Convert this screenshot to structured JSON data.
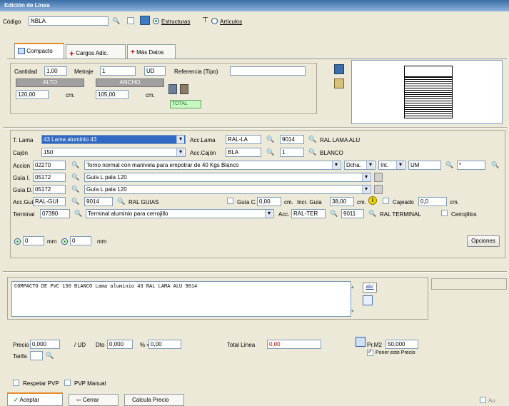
{
  "window": {
    "title": "Edición de Línea"
  },
  "top": {
    "codigo_label": "Código",
    "codigo_value": "NBLA",
    "estructuras_label": "Estructuras",
    "articulos_label": "Artículos"
  },
  "tabs": [
    {
      "label": "Compacto"
    },
    {
      "label": "Cargos Adic."
    },
    {
      "label": "Más Datos"
    }
  ],
  "dims": {
    "cantidad_label": "Cantidad",
    "cantidad_value": "1,00",
    "metraje_label": "Metraje",
    "metraje_value": "1",
    "unit_value": "UD",
    "referencia_label": "Referencia (Tipo)",
    "referencia_value": "",
    "alto_header": "ALTO",
    "ancho_header": "ANCHO",
    "alto_value": "120,00",
    "ancho_value": "105,00",
    "cm_label": "cm.",
    "total_label": "TOTAL"
  },
  "detail": {
    "tlama_label": "T. Lama",
    "tlama_value": "43 Lama aluminio 43",
    "acclama_label": "Acc.Lama",
    "acclama_code": "RAL-LA",
    "acclama_num": "9014",
    "acclama_desc": "RAL LAMA ALU",
    "cajon_label": "Cajón",
    "cajon_value": "150",
    "acccajon_label": "Acc.Cajón",
    "acccajon_code": "BLA",
    "acccajon_num": "1",
    "acccajon_desc": "BLANCO",
    "accion_label": "Accion",
    "accion_code": "02270",
    "accion_desc": "Torno normal con manivela  para empotrar de 40 Kgs Blanco",
    "dcha_value": "Dcha.",
    "int_value": "Int.",
    "um_value": "UM",
    "accion_extra": "*",
    "guiai_label": "Guía I.",
    "guiai_code": "05172",
    "guiai_desc": "Guía L pala 120",
    "guiad_label": "Guía D.",
    "guiad_code": "05172",
    "guiad_desc": "Guía L pala 120",
    "accgui_label": "Acc.Guí",
    "accgui_code": "RAL-GUI",
    "accgui_num": "9014",
    "accgui_desc": "RAL GUIAS",
    "guiac_label": "Guía C.",
    "guiac_value": "0,00",
    "cm_label": "cm.",
    "incr_label": "Incr. Guía",
    "incr_value": "38,00",
    "cajeado_label": "Cajeado",
    "cajeado_value": "0,0",
    "terminal_label": "Terminal",
    "terminal_code": "07390",
    "terminal_desc": "Terminal aluminio para cerrojillo",
    "accter_label": "Acc.",
    "accter_code": "RAL-TER",
    "accter_num": "9011",
    "accter_desc": "RAL TERMINAL",
    "cerrojillos_label": "Cerrojillos",
    "mm1_value": "0",
    "mm2_value": "0",
    "mm_label": "mm",
    "opciones_label": "Opciones"
  },
  "desc": {
    "text": "COMPACTO DE PVC  150  BLANCO  Lama aluminio 43  RAL LAMA ALU 9014",
    "abc_label": "abc"
  },
  "price": {
    "precio_label": "Precio",
    "precio_value": "0,000",
    "per_ud": "/ UD",
    "dto_label": "Dto",
    "dto_value": "0,000",
    "pct_label": "% =",
    "pct_value": "0,00",
    "total_label": "Total Línea",
    "total_value": "0,00",
    "prm2_label": "Pr.M2",
    "prm2_value": "50,000",
    "poner_label": "Poner este Precio",
    "tarifa_label": "Tarifa",
    "respetar_label": "Respetar PVP",
    "pvp_manual_label": "PVP Manual"
  },
  "footer": {
    "aceptar": "Aceptar",
    "cerrar": "Cerrar",
    "calcula": "Calcula Precio",
    "corner": "Au"
  },
  "colors": {
    "title_bar": "#3a6ea5",
    "background": "#ece9d8",
    "selection": "#316ac5"
  }
}
